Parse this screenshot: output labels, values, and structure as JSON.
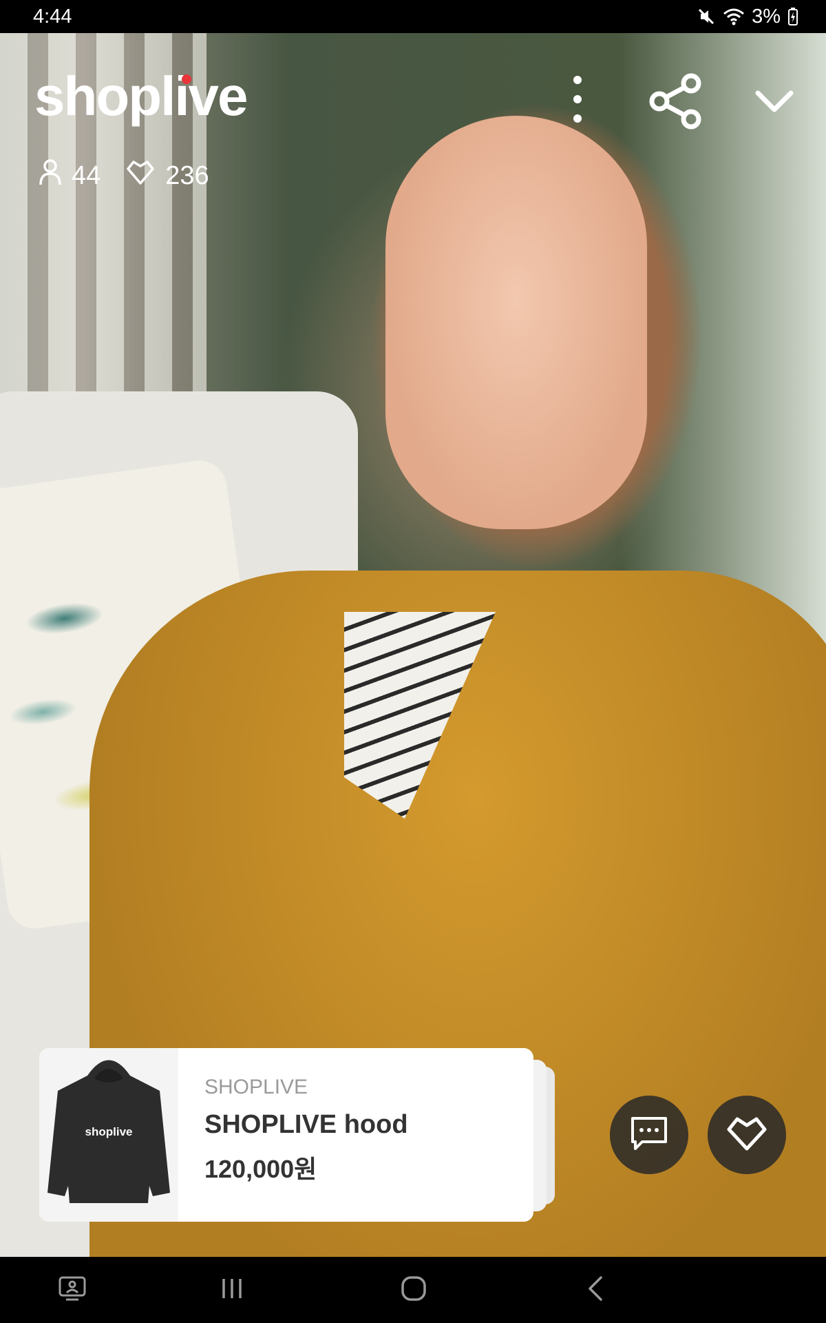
{
  "status_bar": {
    "time": "4:44",
    "battery": "3%",
    "icons": [
      "mute-icon",
      "wifi-icon",
      "battery-charging-icon"
    ]
  },
  "header": {
    "logo": "shoplive",
    "viewers_count": "44",
    "likes_count": "236",
    "icons": [
      "more-vertical-icon",
      "share-icon",
      "chevron-down-icon"
    ]
  },
  "product_card": {
    "brand": "SHOPLIVE",
    "title": "SHOPLIVE hood",
    "price": "120,000원",
    "thumbnail_text": "shoplive"
  },
  "actions": {
    "icons": [
      "chat-icon",
      "heart-icon"
    ]
  },
  "nav_bar": {
    "icons": [
      "screenshot-icon",
      "recent-apps-icon",
      "home-icon",
      "back-icon"
    ]
  },
  "colors": {
    "logo_accent": "#e8363a",
    "overlay_button": "#282828",
    "card_background": "#ffffff"
  }
}
